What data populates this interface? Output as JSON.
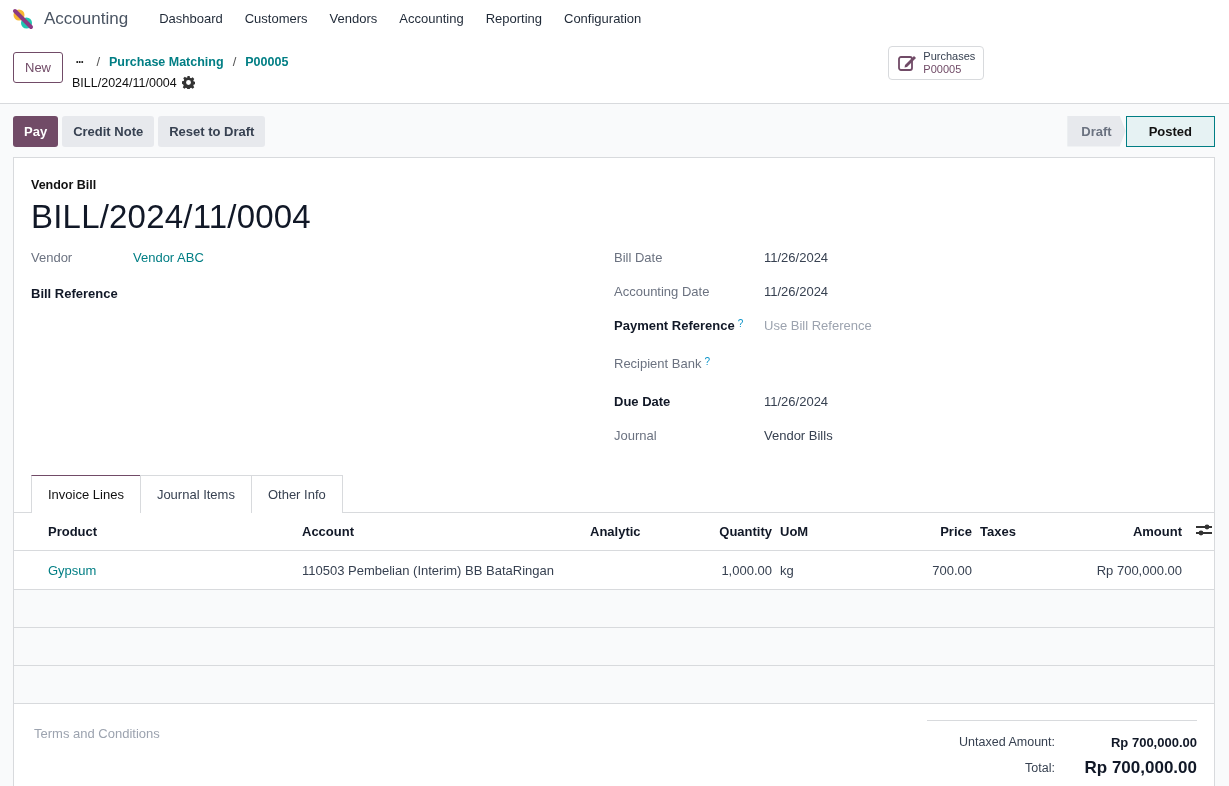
{
  "app": {
    "name": "Accounting",
    "menu": [
      "Dashboard",
      "Customers",
      "Vendors",
      "Accounting",
      "Reporting",
      "Configuration"
    ]
  },
  "control": {
    "new_button": "New",
    "more": "•••",
    "separator": "/",
    "breadcrumbs": [
      "Purchase Matching",
      "P00005"
    ],
    "record": "BILL/2024/11/0004"
  },
  "smart_button": {
    "label": "Purchases",
    "value": "P00005"
  },
  "actions": [
    {
      "label": "Pay",
      "primary": true
    },
    {
      "label": "Credit Note",
      "primary": false
    },
    {
      "label": "Reset to Draft",
      "primary": false
    }
  ],
  "statusbar": [
    {
      "label": "Draft",
      "selected": false
    },
    {
      "label": "Posted",
      "selected": true
    }
  ],
  "form": {
    "type_label": "Vendor Bill",
    "title": "BILL/2024/11/0004",
    "left_fields": [
      {
        "label": "Vendor",
        "value": "Vendor ABC",
        "kind": "link",
        "required": false
      },
      {
        "label": "Bill Reference",
        "kind": "empty",
        "required": true
      }
    ],
    "right_fields": [
      {
        "label": "Bill Date",
        "value": "11/26/2024",
        "kind": "text",
        "required": false
      },
      {
        "label": "Accounting Date",
        "value": "11/26/2024",
        "kind": "text",
        "required": false
      },
      {
        "label": "Payment Reference",
        "help": "?",
        "placeholder": "Use Bill Reference",
        "kind": "placeholder",
        "required": true
      },
      {
        "label": "Recipient Bank",
        "help": "?",
        "kind": "empty",
        "required": false
      },
      {
        "label": "Due Date",
        "value": "11/26/2024",
        "kind": "text",
        "required": true
      },
      {
        "label": "Journal",
        "value": "Vendor Bills",
        "kind": "text",
        "required": false
      }
    ]
  },
  "tabs": [
    {
      "label": "Invoice Lines",
      "selected": true
    },
    {
      "label": "Journal Items",
      "selected": false
    },
    {
      "label": "Other Info",
      "selected": false
    }
  ],
  "table": {
    "columns": [
      "Product",
      "Account",
      "Analytic",
      "Quantity",
      "UoM",
      "Price",
      "Taxes",
      "Amount"
    ],
    "rows": [
      {
        "cells": [
          "Gypsum",
          "110503 Pembelian (Interim) BB BataRingan",
          "",
          "1,000.00",
          "kg",
          "700.00",
          "",
          "Rp 700,000.00"
        ]
      }
    ]
  },
  "footer": {
    "terms_placeholder": "Terms and Conditions",
    "totals": [
      {
        "label": "Untaxed Amount:",
        "value": "Rp 700,000.00",
        "grand": false
      },
      {
        "label": "Total:",
        "value": "Rp 700,000.00",
        "grand": true
      }
    ]
  }
}
